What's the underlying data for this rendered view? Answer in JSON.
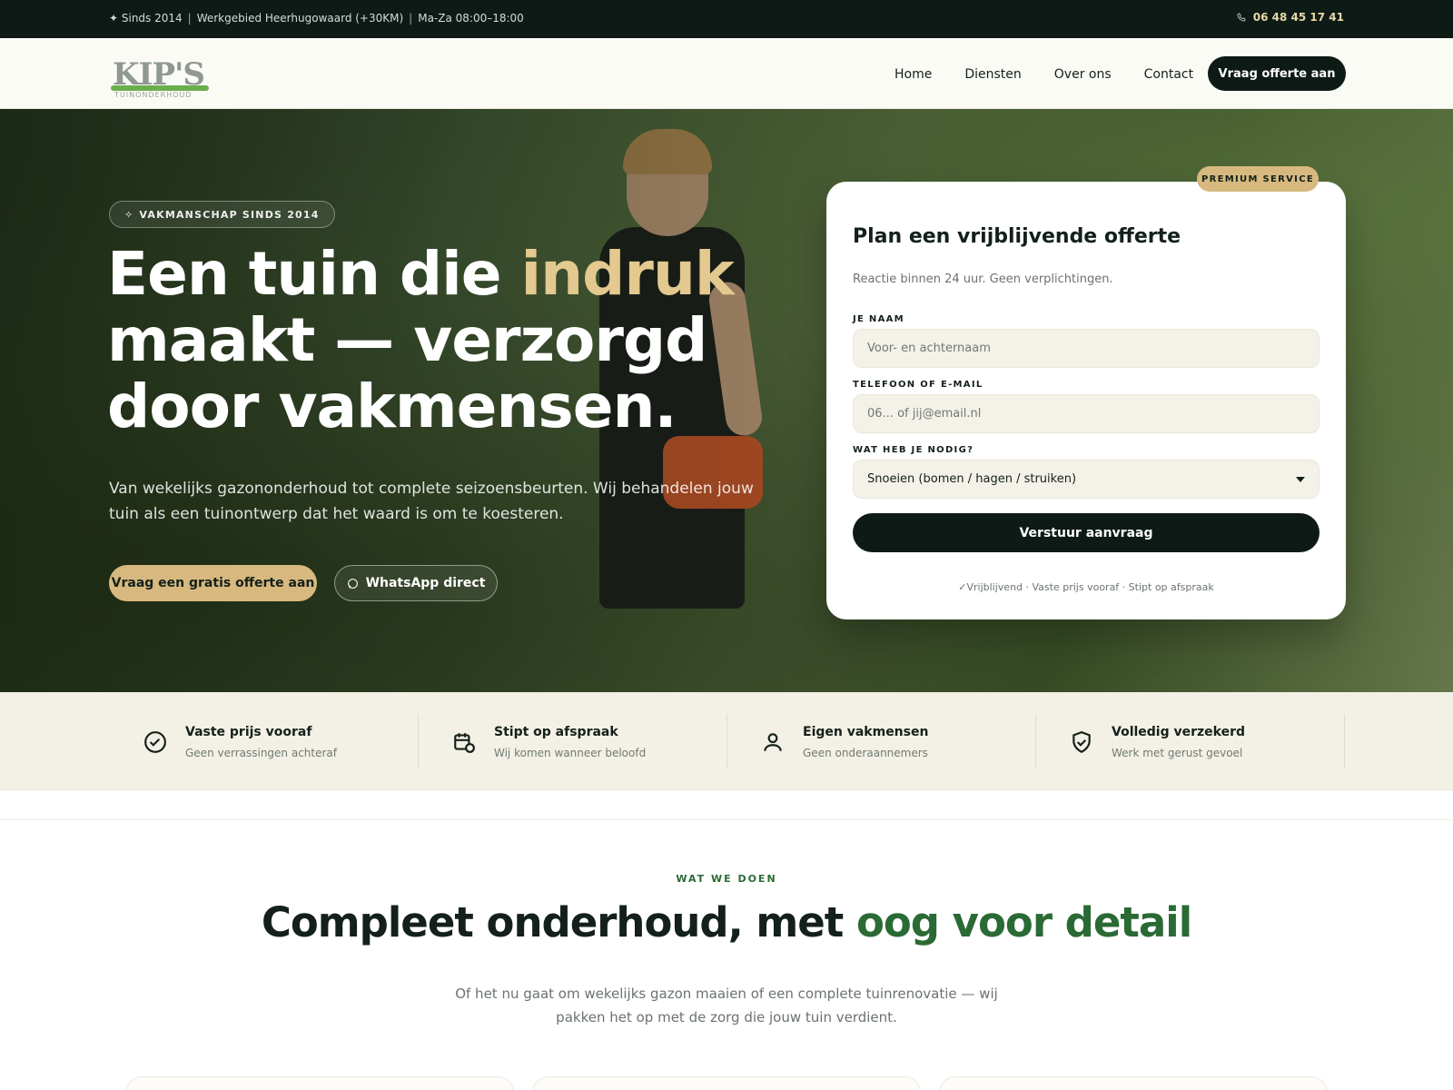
{
  "topbar": {
    "since": "✦ Sinds 2014",
    "sep1": "|",
    "area": "Werkgebied Heerhugowaard (+30KM)",
    "sep2": "|",
    "hours": "Ma-Za 08:00–18:00",
    "phone_icon": "phone-icon",
    "phone": "06 48 45 17 41"
  },
  "header": {
    "logo_text": "KIP'S",
    "logo_sub": "TUINONDERHOUD",
    "nav": [
      "Home",
      "Diensten",
      "Over ons",
      "Contact"
    ],
    "cta": "Vraag offerte aan"
  },
  "hero": {
    "badge": "VAKMANSCHAP SINDS 2014",
    "badge_icon": "sparkle-icon",
    "title_part1": "Een tuin die ",
    "title_accent": "indruk",
    "title_part2": "maakt — verzorgd door vakmensen.",
    "lead": "Van wekelijks gazononderhoud tot complete seizoensbeurten. Wij behandelen jouw tuin als een tuinontwerp dat het waard is om te koesteren.",
    "btn_primary": "Vraag een gratis offerte aan",
    "btn_secondary": "WhatsApp direct",
    "btn_secondary_icon": "whatsapp-icon"
  },
  "form": {
    "pill": "PREMIUM SERVICE",
    "title": "Plan een vrijblijvende offerte",
    "subtitle": "Reactie binnen 24 uur. Geen verplichtingen.",
    "name_label": "JE NAAM",
    "name_placeholder": "Voor- en achternaam",
    "contact_label": "TELEFOON OF E-MAIL",
    "contact_placeholder": "06... of jij@email.nl",
    "need_label": "WAT HEB JE NODIG?",
    "need_value": "Snoeien (bomen / hagen / struiken)",
    "submit": "Verstuur aanvraag",
    "footnote": "✓Vrijblijvend · Vaste prijs vooraf · Stipt op afspraak"
  },
  "features": [
    {
      "icon": "check-circle-icon",
      "title": "Vaste prijs vooraf",
      "desc": "Geen verrassingen achteraf"
    },
    {
      "icon": "calendar-clock-icon",
      "title": "Stipt op afspraak",
      "desc": "Wij komen wanneer beloofd"
    },
    {
      "icon": "user-icon",
      "title": "Eigen vakmensen",
      "desc": "Geen onderaannemers"
    },
    {
      "icon": "shield-check-icon",
      "title": "Volledig verzekerd",
      "desc": "Werk met gerust gevoel"
    }
  ],
  "services": {
    "eyebrow": "WAT WE DOEN",
    "title_part1": "Compleet onderhoud, met ",
    "title_accent": "oog voor detail",
    "para": "Of het nu gaat om wekelijks gazon maaien of een complete tuinrenovatie — wij pakken het op met de zorg die jouw tuin verdient."
  },
  "colors": {
    "dark": "#0d1a15",
    "gold": "#d7b97f",
    "green_accent": "#2a6a34",
    "cream": "#f3f0e6"
  }
}
